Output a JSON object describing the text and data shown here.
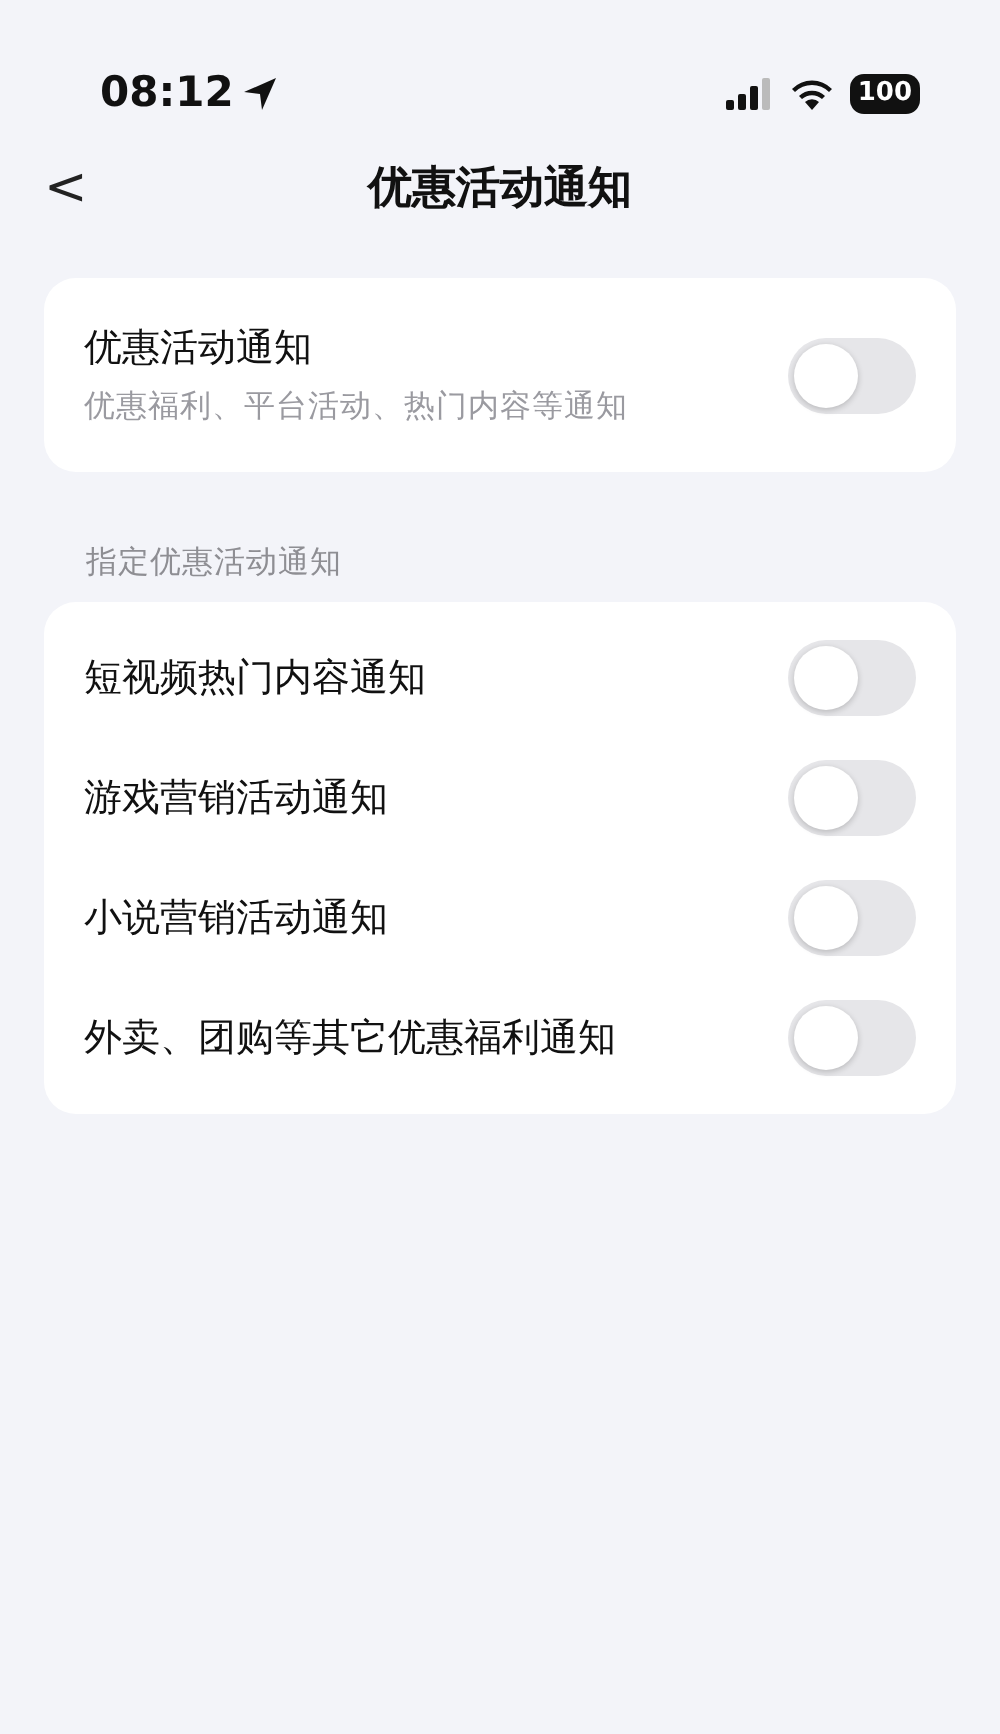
{
  "status_bar": {
    "time": "08:12",
    "battery": "100"
  },
  "header": {
    "back": "<",
    "title": "优惠活动通知"
  },
  "main_setting": {
    "label": "优惠活动通知",
    "description": "优惠福利、平台活动、热门内容等通知",
    "on": false
  },
  "section": {
    "title": "指定优惠活动通知",
    "items": [
      {
        "label": "短视频热门内容通知",
        "on": false
      },
      {
        "label": "游戏营销活动通知",
        "on": false
      },
      {
        "label": "小说营销活动通知",
        "on": false
      },
      {
        "label": "外卖、团购等其它优惠福利通知",
        "on": false
      }
    ]
  }
}
